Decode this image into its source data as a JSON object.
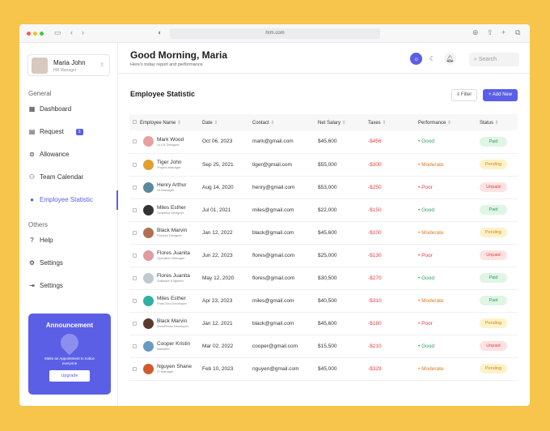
{
  "browser": {
    "url": "hrm.com"
  },
  "user": {
    "name": "Maria John",
    "role": "HR Manager"
  },
  "sidebar": {
    "general_label": "General",
    "others_label": "Others",
    "items": [
      {
        "label": "Dashboard",
        "icon": "dashboard-icon"
      },
      {
        "label": "Request",
        "icon": "request-icon",
        "badge": "3"
      },
      {
        "label": "Allowance",
        "icon": "allowance-icon"
      },
      {
        "label": "Team Calendar",
        "icon": "team-icon"
      },
      {
        "label": "Employee Statistic",
        "icon": "user-icon",
        "active": true
      }
    ],
    "others": [
      {
        "label": "Help",
        "icon": "help-icon"
      },
      {
        "label": "Settings",
        "icon": "gear-icon"
      },
      {
        "label": "Settings",
        "icon": "logout-icon"
      }
    ]
  },
  "announcement": {
    "title": "Announcement",
    "text": "Make an Appointment to notice everyone",
    "button": "Upgrade"
  },
  "header": {
    "greeting": "Good Morning, Maria",
    "subtitle": "Here's today report and performance",
    "search_placeholder": "Search"
  },
  "section": {
    "title": "Employee Statistic",
    "filter": "Filter",
    "add": "+ Add New"
  },
  "columns": [
    "Employee Name",
    "Date",
    "Contact",
    "Net Salary",
    "Taxes",
    "Performance",
    "Status"
  ],
  "rows": [
    {
      "name": "Mark Wood",
      "role": "UI UX Designer",
      "date": "Oct 06, 2023",
      "contact": "mark@gmail.com",
      "salary": "$45,600",
      "tax": "-$456",
      "perf": "Good",
      "status": "Paid",
      "color": "#e8a0a0"
    },
    {
      "name": "Tiger John",
      "role": "Project Manager",
      "date": "Sep 25, 2021",
      "contact": "tiger@gmail.com",
      "salary": "$55,000",
      "tax": "-$300",
      "perf": "Moderate",
      "status": "Pending",
      "color": "#e0a030"
    },
    {
      "name": "Henry Arthur",
      "role": "Hr Manager",
      "date": "Aug 14, 2020",
      "contact": "henry@gmail.com",
      "salary": "$53,000",
      "tax": "-$250",
      "perf": "Poor",
      "status": "Unpaid",
      "color": "#5a8a9a"
    },
    {
      "name": "Miles Esther",
      "role": "Graphics Designer",
      "date": "Jul 01, 2021",
      "contact": "miles@gmail.com",
      "salary": "$22,000",
      "tax": "-$150",
      "perf": "Good",
      "status": "Paid",
      "color": "#333333"
    },
    {
      "name": "Black Marvin",
      "role": "Product Designer",
      "date": "Jan 12, 2022",
      "contact": "black@gmail.com",
      "salary": "$45,600",
      "tax": "-$100",
      "perf": "Moderate",
      "status": "Pending",
      "color": "#b07050"
    },
    {
      "name": "Flores Juanita",
      "role": "Operation Manager",
      "date": "Jun 22, 2023",
      "contact": "flores@gmail.com",
      "salary": "$25,000",
      "tax": "-$130",
      "perf": "Poor",
      "status": "Unpaid",
      "color": "#e09aa0"
    },
    {
      "name": "Flores Juanita",
      "role": "Software Engineer",
      "date": "May 12, 2020",
      "contact": "flores@gmail.com",
      "salary": "$30,500",
      "tax": "-$270",
      "perf": "Good",
      "status": "Paid",
      "color": "#c0c8d0"
    },
    {
      "name": "Miles Esther",
      "role": "Front End Developer",
      "date": "Apr 23, 2023",
      "contact": "miles@gmail.com",
      "salary": "$40,500",
      "tax": "-$310",
      "perf": "Moderate",
      "status": "Paid",
      "color": "#30b0a0"
    },
    {
      "name": "Black Marvin",
      "role": "WordPress Developer",
      "date": "Jan 12, 2021",
      "contact": "black@gmail.com",
      "salary": "$45,600",
      "tax": "-$180",
      "perf": "Poor",
      "status": "Pending",
      "color": "#5a3a30"
    },
    {
      "name": "Cooper Kristin",
      "role": "Marketer",
      "date": "Mar 02, 2022",
      "contact": "cooper@gmail.com",
      "salary": "$15,500",
      "tax": "-$210",
      "perf": "Good",
      "status": "Unpaid",
      "color": "#6a9ac0"
    },
    {
      "name": "Nguyen Shane",
      "role": "IT Manager",
      "date": "Feb 10, 2023",
      "contact": "nguyen@gmail.com",
      "salary": "$45,000",
      "tax": "-$329",
      "perf": "Moderate",
      "status": "Pending",
      "color": "#d05a30"
    }
  ],
  "colors": {
    "accent": "#5b5fe6",
    "good": "#2e9e5b",
    "moderate": "#e07a20",
    "poor": "#e04040",
    "tax": "#e04040"
  }
}
